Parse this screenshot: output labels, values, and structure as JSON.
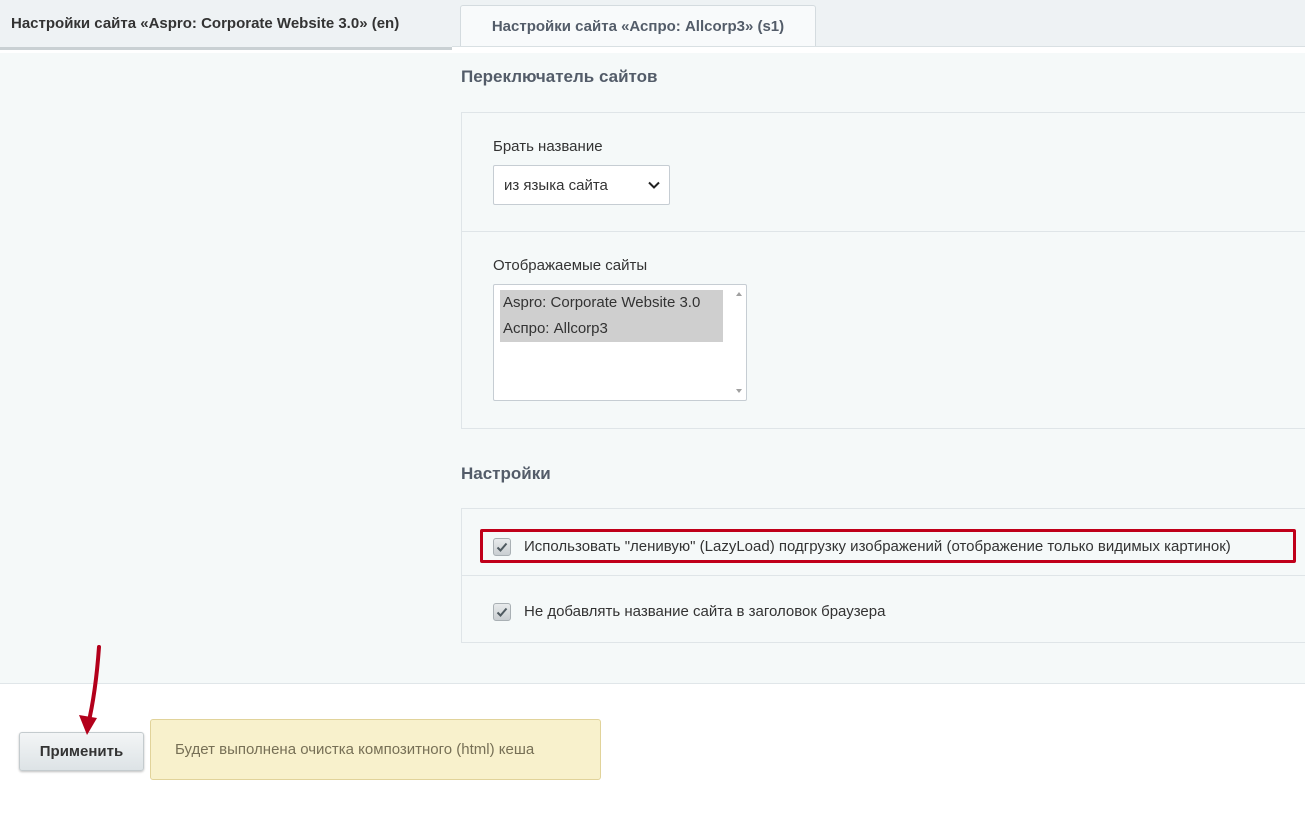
{
  "tabs": [
    {
      "label": "Настройки сайта «Aspro: Corporate Website 3.0» (en)",
      "active": true
    },
    {
      "label": "Настройки сайта «Аспро: Allcorp3» (s1)",
      "active": false
    }
  ],
  "site_switcher": {
    "title": "Переключатель сайтов",
    "name_source": {
      "label": "Брать название",
      "value": "из языка сайта"
    },
    "displayed_sites": {
      "label": "Отображаемые сайты",
      "options": [
        "Aspro: Corporate Website 3.0",
        "Аспро: Allcorp3"
      ]
    }
  },
  "settings": {
    "title": "Настройки",
    "lazyload": {
      "label": "Использовать \"ленивую\" (LazyLoad) подгрузку изображений (отображение только видимых картинок)",
      "checked": true
    },
    "no_site_name": {
      "label": "Не добавлять название сайта в заголовок браузера",
      "checked": true
    }
  },
  "footer": {
    "apply_label": "Применить",
    "notice": "Будет выполнена очистка композитного (html) кеша"
  },
  "colors": {
    "highlight": "#c0001a",
    "notice_bg": "#f8f1cc"
  }
}
